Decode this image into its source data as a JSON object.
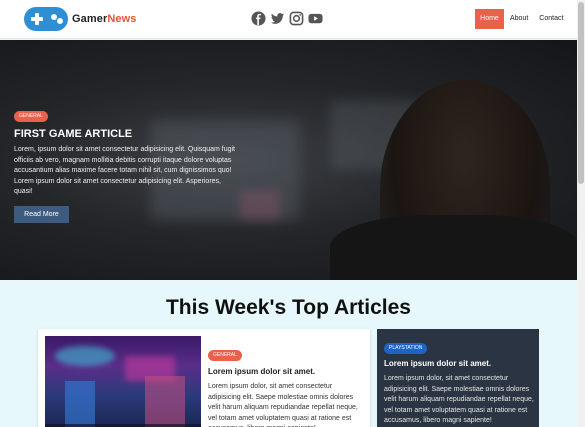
{
  "header": {
    "brand_main": "Gamer",
    "brand_accent": "News",
    "socials": [
      "facebook-icon",
      "twitter-icon",
      "instagram-icon",
      "youtube-icon"
    ],
    "nav": [
      "Home",
      "About",
      "Contact"
    ],
    "active_nav": "Home"
  },
  "hero": {
    "tag": "GENERAL",
    "title": "FIRST GAME ARTICLE",
    "text": "Lorem, ipsum dolor sit amet consectetur adipisicing elit. Quisquam fugit officiis ab vero, magnam mollitia debitis corrupti itaque dolore voluptas accusantium alias maxime facere totam nihil sit, cum dignissimos quo! Lorem ipsum dolor sit amet consectetur adipisicing elit. Asperiores, quasi!",
    "button": "Read More"
  },
  "section": {
    "title": "This Week's Top Articles"
  },
  "cards": [
    {
      "tag": "GENERAL",
      "title": "Lorem ipsum dolor sit amet.",
      "text": "Lorem ipsum dolor, sit amet consectetur adipisicing elit. Saepe molestiae omnis dolores velit harum aliquam repudiandae repellat neque, vel totam amet voluptatem quasi at ratione est accusamus, libero magni sapiente!"
    },
    {
      "tag": "PLAYSTATION",
      "title": "Lorem ipsum dolor sit amet.",
      "text": "Lorem ipsum dolor, sit amet consectetur adipisicing elit. Saepe molestiae omnis dolores velit harum aliquam repudiandae repellat neque, vel totam amet voluptatem quasi at ratione est accusamus, libero magni sapiente!"
    }
  ],
  "colors": {
    "accent": "#e9614a",
    "brand_blue": "#2e8fd4",
    "button": "#3d5a80",
    "playstation": "#1e64c8",
    "dark_card": "#2b3442",
    "section_bg": "#e6f8fb"
  }
}
